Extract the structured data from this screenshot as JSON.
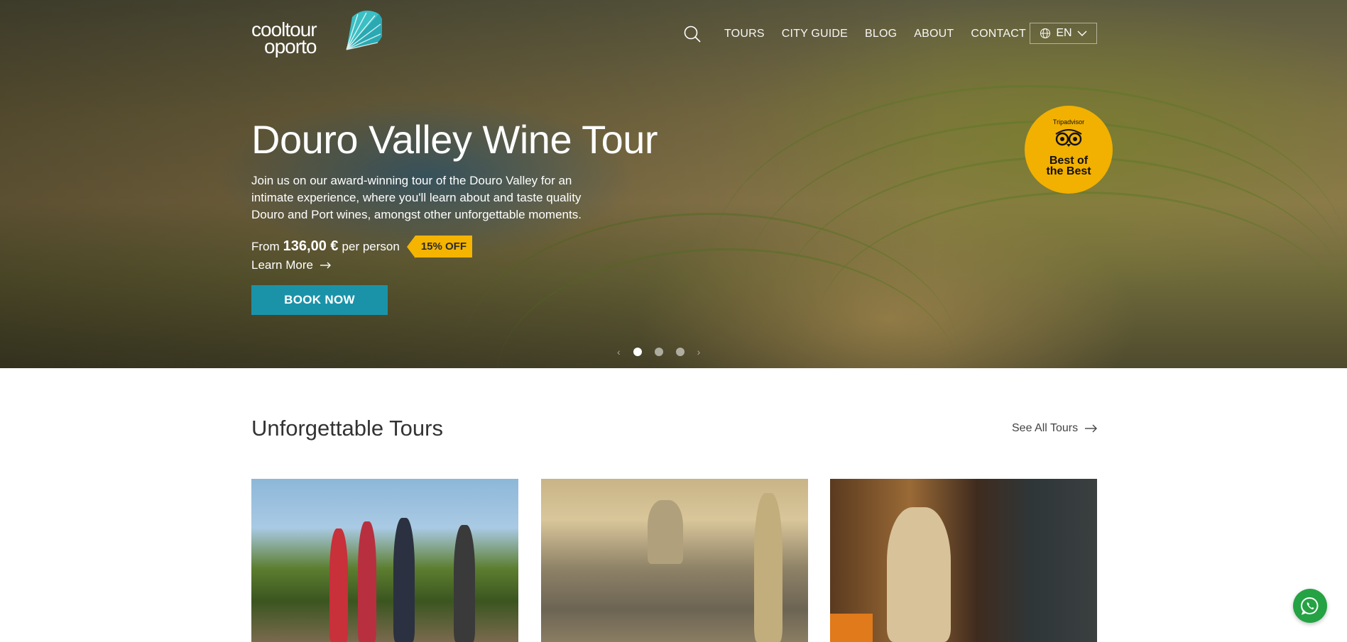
{
  "brand": {
    "line1": "cooltour",
    "line2": "oporto"
  },
  "nav": {
    "items": [
      "TOURS",
      "CITY GUIDE",
      "BLOG",
      "ABOUT",
      "CONTACT"
    ],
    "language": "EN"
  },
  "hero": {
    "title": "Douro Valley Wine Tour",
    "description": "Join us on our award-winning tour of the Douro Valley for an intimate experience, where you'll learn about and taste quality Douro and Port wines, amongst other unforgettable moments.",
    "price_prefix": "From",
    "price": "136,00 €",
    "price_suffix": "per person",
    "discount": "15% OFF",
    "learn_more": "Learn More",
    "book_now": "BOOK NOW",
    "slide_count": 3,
    "active_slide": 1
  },
  "award": {
    "brand": "Tripadvisor",
    "line1": "Best of",
    "line2": "the Best"
  },
  "section": {
    "title": "Unforgettable Tours",
    "see_all": "See All Tours"
  },
  "colors": {
    "accent": "#1a93a9",
    "badge": "#f4b400",
    "award": "#f2b000",
    "whatsapp": "#25a244"
  }
}
